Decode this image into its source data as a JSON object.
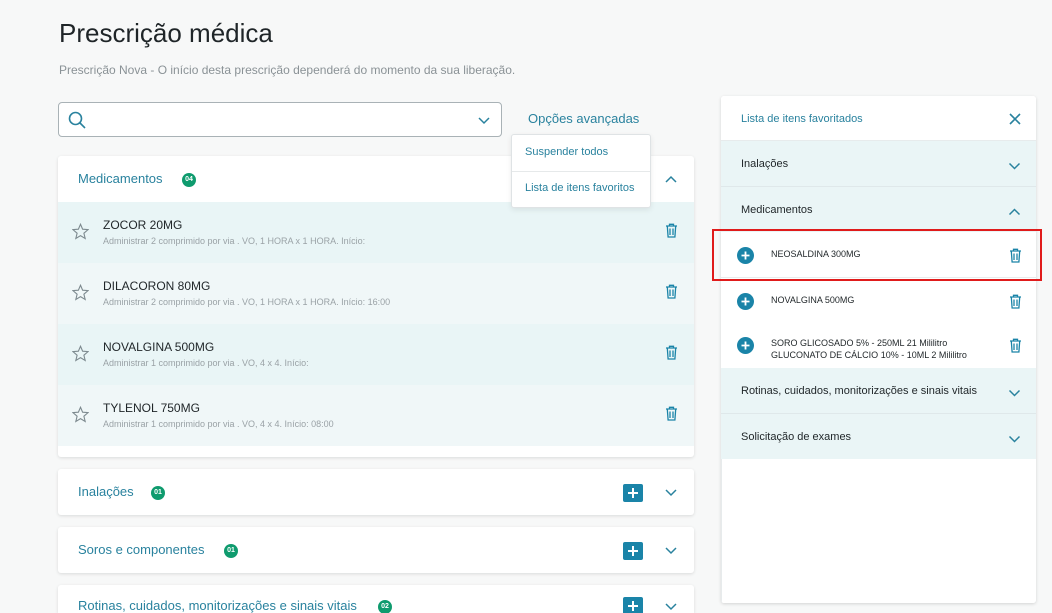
{
  "page": {
    "title": "Prescrição médica",
    "subtitle": "Prescrição Nova - O início desta prescrição dependerá do momento da sua liberação."
  },
  "search": {
    "placeholder": "",
    "value": ""
  },
  "advanced_options": {
    "label": "Opções avançadas",
    "menu": [
      "Suspender todos",
      "Lista de itens favoritos"
    ]
  },
  "sections": [
    {
      "title": "Medicamentos",
      "count": "04",
      "expanded": true,
      "items": [
        {
          "name": "ZOCOR 20MG",
          "detail": "Administrar 2 comprimido por via . VO, 1 HORA x 1 HORA. Início:"
        },
        {
          "name": "DILACORON 80MG",
          "detail": "Administrar 2 comprimido por via . VO, 1 HORA x 1 HORA. Início: 16:00"
        },
        {
          "name": "NOVALGINA 500MG",
          "detail": "Administrar 1 comprimido por via . VO, 4 x 4. Início:"
        },
        {
          "name": "TYLENOL 750MG",
          "detail": "Administrar 1 comprimido por via . VO, 4 x 4. Início: 08:00"
        }
      ]
    },
    {
      "title": "Inalações",
      "count": "01",
      "expanded": false
    },
    {
      "title": "Soros e componentes",
      "count": "01",
      "expanded": false
    },
    {
      "title": "Rotinas, cuidados, monitorizações e sinais vitais",
      "count": "02",
      "expanded": false
    }
  ],
  "favorites": {
    "title": "Lista de itens favoritados",
    "sections": [
      {
        "title": "Inalações",
        "expanded": false
      },
      {
        "title": "Medicamentos",
        "expanded": true,
        "items": [
          {
            "name": "NEOSALDINA 300MG"
          },
          {
            "name": "NOVALGINA 500MG"
          },
          {
            "name": "SORO GLICOSADO 5% - 250ML 21 Mililitro",
            "name2": "GLUCONATO DE CÁLCIO 10% - 10ML 2 Mililitro"
          }
        ]
      },
      {
        "title": "Rotinas, cuidados, monitorizações e sinais vitais",
        "expanded": false
      },
      {
        "title": "Solicitação de exames",
        "expanded": false
      }
    ]
  },
  "colors": {
    "accent": "#29829e",
    "badge": "#0f9b6e",
    "row_bg": "#e9f5f6",
    "highlight": "#e01b1b"
  }
}
